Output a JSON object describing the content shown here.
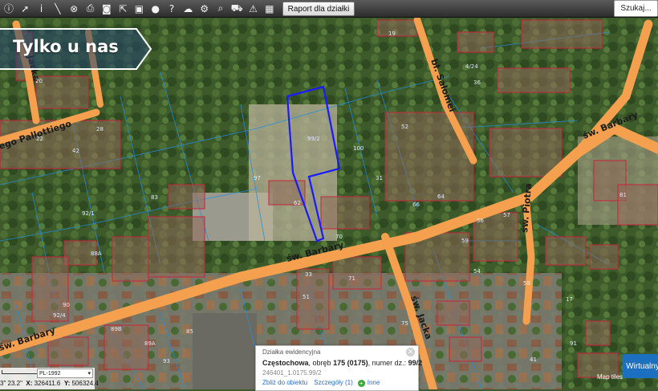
{
  "toolbar": {
    "tools": [
      {
        "name": "map-info-icon",
        "glyph": "ⓘ"
      },
      {
        "name": "pointer-icon",
        "glyph": "➚"
      },
      {
        "name": "info-icon",
        "glyph": "i"
      },
      {
        "name": "measure-icon",
        "glyph": "╲"
      },
      {
        "name": "link-icon",
        "glyph": "⊗"
      },
      {
        "name": "print-icon",
        "glyph": "⎙"
      },
      {
        "name": "camera-icon",
        "glyph": "◙"
      },
      {
        "name": "export-icon",
        "glyph": "⇱"
      },
      {
        "name": "layers-icon",
        "glyph": "▣"
      },
      {
        "name": "comment-icon",
        "glyph": "●"
      },
      {
        "name": "help-icon",
        "glyph": "?"
      },
      {
        "name": "cloud-icon",
        "glyph": "☁"
      },
      {
        "name": "settings-icon",
        "glyph": "⚙"
      },
      {
        "name": "zoom-icon",
        "glyph": "⌕"
      },
      {
        "name": "cart-icon",
        "glyph": "⛟"
      },
      {
        "name": "warning-icon",
        "glyph": "⚠"
      },
      {
        "name": "apps-icon",
        "glyph": "▦"
      }
    ],
    "report_label": "Raport dla działki",
    "search_label": "Szukaj..."
  },
  "promo": {
    "text": "Tylko u nas"
  },
  "map": {
    "roads": [
      {
        "name": "św. Barbary"
      },
      {
        "name": "św. Barbary"
      },
      {
        "name": "św. Barbary"
      },
      {
        "name": "św. Jacka"
      },
      {
        "name": "św. Piotra"
      },
      {
        "name": "bł. Salomei"
      },
      {
        "name": "ego Pallottiego"
      },
      {
        "name": "Jacka"
      }
    ],
    "parcels": [
      "99/2",
      "100",
      "97",
      "62",
      "92/1",
      "88A",
      "64",
      "90",
      "92/4",
      "83",
      "81",
      "17",
      "85",
      "33",
      "66",
      "70",
      "56",
      "59",
      "57",
      "54",
      "58",
      "52",
      "31",
      "36",
      "42",
      "28",
      "22",
      "24",
      "19",
      "20",
      "4/24",
      "51",
      "71",
      "75",
      "41",
      "91",
      "93",
      "89B",
      "89A"
    ]
  },
  "popup": {
    "title": "Działka ewidencyjna",
    "city": "Częstochowa",
    "obreb_label": ", obręb",
    "obreb_value": "175 (0175)",
    "numer_label": ", numer dz.:",
    "numer_value": "99/2",
    "id": "246401_1.0175.99/2",
    "link_zoom": "Zbliż do obiektu",
    "link_details": "Szczegóły (1)",
    "link_more": "Inne"
  },
  "status": {
    "crs": "PL-1992",
    "coord_prefix": "3\" 23.2\"",
    "x_label": "X:",
    "x_value": "326411.6",
    "y_label": "Y:",
    "y_value": "506324.4"
  },
  "virtual_label": "Wirtualny",
  "tiles_label": "Map tiles",
  "colors": {
    "road": "#f5a04e",
    "parcel_line": "#1e8fe6",
    "selected": "#1a1aff",
    "building": "#c8233a"
  }
}
